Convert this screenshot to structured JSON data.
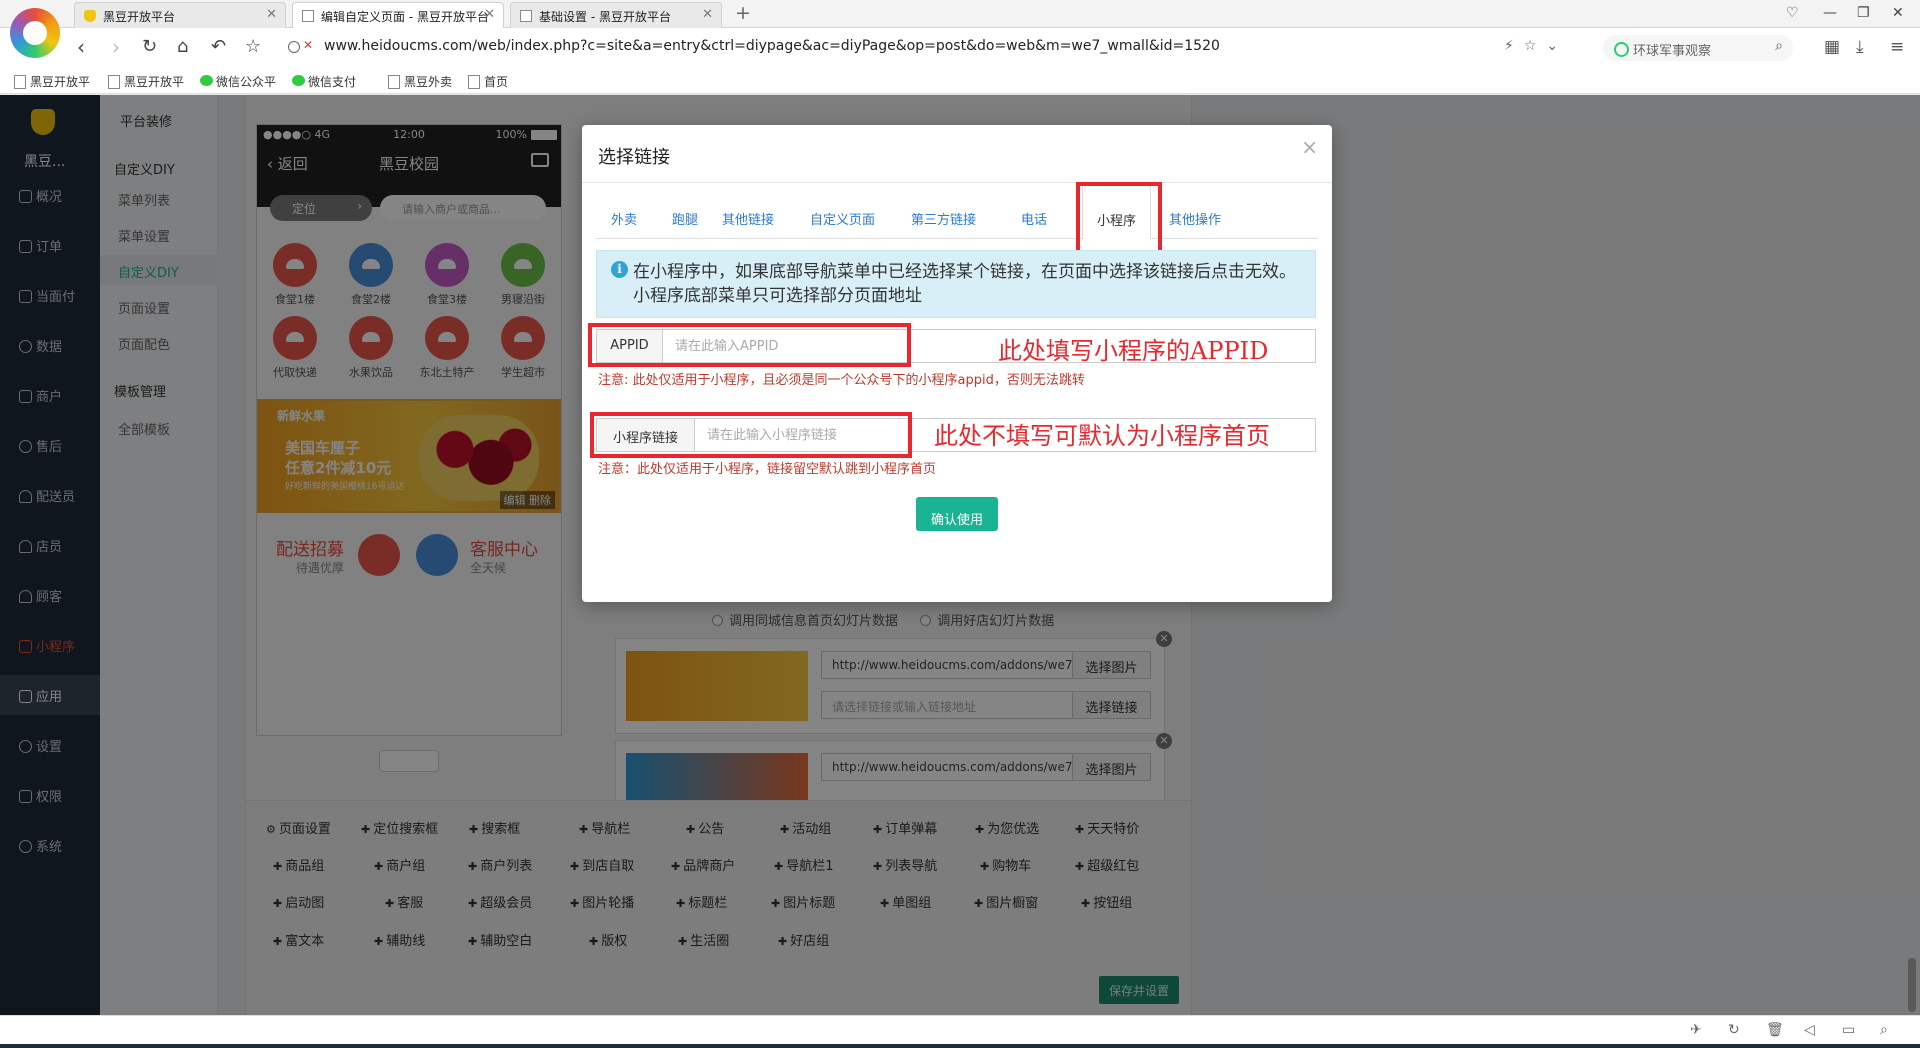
{
  "browser": {
    "tabs": [
      {
        "label": "黑豆开放平台",
        "active": false
      },
      {
        "label": "编辑自定义页面 - 黑豆开放平台",
        "active": true
      },
      {
        "label": "基础设置 - 黑豆开放平台",
        "active": false
      }
    ],
    "url": "www.heidoucms.com/web/index.php?c=site&a=entry&ctrl=diypage&ac=diyPage&op=post&do=web&m=we7_wmall&id=1520",
    "search_placeholder": "环球军事观察",
    "bookmarks": [
      "黑豆开放平",
      "黑豆开放平",
      "微信公众平",
      "微信支付",
      "黑豆外卖",
      "首页"
    ]
  },
  "leftnav": {
    "shop_name": "黑豆...",
    "items": [
      {
        "label": "概况"
      },
      {
        "label": "订单"
      },
      {
        "label": "当面付"
      },
      {
        "label": "数据"
      },
      {
        "label": "商户"
      },
      {
        "label": "售后"
      },
      {
        "label": "配送员"
      },
      {
        "label": "店员"
      },
      {
        "label": "顾客"
      },
      {
        "label": "小程序"
      },
      {
        "label": "应用"
      },
      {
        "label": "设置"
      },
      {
        "label": "权限"
      },
      {
        "label": "系统"
      }
    ]
  },
  "subnav": {
    "title": "平台装修",
    "group1": "自定义DIY",
    "items1": [
      "菜单列表",
      "菜单设置",
      "自定义DIY",
      "页面设置",
      "页面配色"
    ],
    "group2": "模板管理",
    "items2": [
      "全部模板"
    ]
  },
  "phone": {
    "carrier": "●●●●○ 4G",
    "time": "12:00",
    "battery": "100%",
    "back": "返回",
    "title": "黑豆校园",
    "location": "定位",
    "search_placeholder": "请输入商户或商品...",
    "grid": [
      {
        "label": "食堂1楼",
        "color": "#e8574a"
      },
      {
        "label": "食堂2楼",
        "color": "#4a8fd8"
      },
      {
        "label": "食堂3楼",
        "color": "#c35ac8"
      },
      {
        "label": "男寝沿街",
        "color": "#6cc04a"
      },
      {
        "label": "代取快递",
        "color": "#e8574a"
      },
      {
        "label": "水果饮品",
        "color": "#e8574a"
      },
      {
        "label": "东北土特产",
        "color": "#e8574a"
      },
      {
        "label": "学生超市",
        "color": "#e8574a"
      }
    ],
    "banner": {
      "tag": "新鲜水果",
      "line1": "美国车厘子",
      "line2": "任意2件减10元",
      "line3": "好吃新鲜的美国樱桃16号运达",
      "actions": "编辑  删除"
    },
    "cards": [
      {
        "title": "配送招募",
        "sub": "待遇优厚",
        "color": "#e8574a"
      },
      {
        "title": "客服中心",
        "sub": "全天候",
        "color": "#4a8fd8"
      }
    ]
  },
  "editor": {
    "slide_option1": "调用同城信息首页幻灯片数据",
    "slide_option2": "调用好店幻灯片数据",
    "slides": [
      {
        "image_url": "http://www.heidoucms.com/addons/we7_w",
        "image_btn": "选择图片",
        "link_placeholder": "请选择链接或输入链接地址",
        "link_btn": "选择链接"
      },
      {
        "image_url": "http://www.heidoucms.com/addons/we7_w",
        "image_btn": "选择图片"
      }
    ],
    "components": [
      "页面设置",
      "定位搜索框",
      "搜索框",
      "导航栏",
      "公告",
      "活动组",
      "订单弹幕",
      "为您优选",
      "天天特价",
      "商品组",
      "商户组",
      "商户列表",
      "到店自取",
      "品牌商户",
      "导航栏1",
      "列表导航",
      "购物车",
      "超级红包",
      "启动图",
      "客服",
      "超级会员",
      "图片轮播",
      "标题栏",
      "图片标题",
      "单图组",
      "图片橱窗",
      "按钮组",
      "富文本",
      "辅助线",
      "辅助空白",
      "版权",
      "生活圈",
      "好店组"
    ],
    "save_btn": "保存并设置"
  },
  "modal": {
    "title": "选择链接",
    "close": "×",
    "tabs": [
      "外卖",
      "跑腿",
      "其他链接",
      "自定义页面",
      "第三方链接",
      "电话",
      "小程序",
      "其他操作"
    ],
    "active_tab": "小程序",
    "info": "在小程序中，如果底部导航菜单中已经选择某个链接，在页面中选择该链接后点击无效。 小程序底部菜单只可选择部分页面地址",
    "appid_label": "APPID",
    "appid_placeholder": "请在此输入APPID",
    "appid_note": "注意: 此处仅适用于小程序，且必须是同一个公众号下的小程序appid，否则无法跳转",
    "link_label": "小程序链接",
    "link_placeholder": "请在此输入小程序链接",
    "link_note": "注意：此处仅适用于小程序，链接留空默认跳到小程序首页",
    "confirm": "确认使用",
    "annotation_appid": "此处填写小程序的APPID",
    "annotation_link": "此处不填写可默认为小程序首页"
  }
}
